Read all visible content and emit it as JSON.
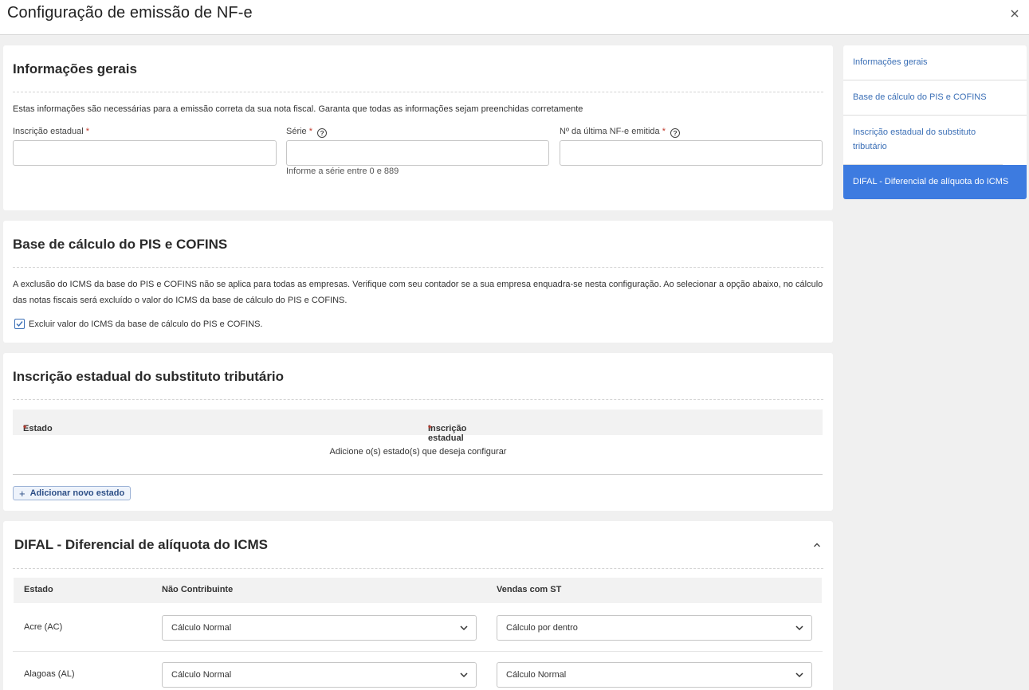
{
  "header": {
    "title": "Configuração de emissão de NF-e"
  },
  "section_general": {
    "title": "Informações gerais",
    "description": "Estas informações são necessárias para a emissão correta da sua nota fiscal. Garanta que todas as informações sejam preenchidas corretamente",
    "state_registration_label": "Inscrição estadual",
    "series_label": "Série",
    "series_hint": "Informe a série entre 0 e 889",
    "last_invoice_label": "Nº da última NF-e emitida",
    "required_mark": "*"
  },
  "section_pis_cofins": {
    "title": "Base de cálculo do PIS e COFINS",
    "description": "A exclusão do ICMS da base do PIS e COFINS não se aplica para todas as empresas. Verifique com seu contador se a sua empresa enquadra-se nesta configuração. Ao selecionar a opção abaixo, no cálculo das notas fiscais será excluído o valor do ICMS da base de cálculo do PIS e COFINS.",
    "checkbox_label": "Excluir valor do ICMS da base de cálculo do PIS e COFINS.",
    "checkbox_checked": true
  },
  "section_substitute": {
    "title": "Inscrição estadual do substituto tributário",
    "columns": [
      "Estado",
      "Inscrição estadual"
    ],
    "empty_message": "Adicione o(s) estado(s) que deseja configurar",
    "add_button": "Adicionar novo estado"
  },
  "section_difal": {
    "title": "DIFAL - Diferencial de alíquota do ICMS",
    "columns": [
      "Estado",
      "Não Contribuinte",
      "Vendas com ST"
    ],
    "rows": [
      {
        "state": "Acre (AC)",
        "non_contributor": "Cálculo Normal",
        "st_sales": "Cálculo por dentro"
      },
      {
        "state": "Alagoas (AL)",
        "non_contributor": "Cálculo Normal",
        "st_sales": "Cálculo Normal"
      }
    ]
  },
  "sidenav": {
    "items": [
      "Informações gerais",
      "Base de cálculo do PIS e COFINS",
      "Inscrição estadual do substituto tributário",
      "DIFAL - Diferencial de alíquota do ICMS"
    ],
    "active_index": 3
  },
  "colors": {
    "accent": "#3d7be0",
    "link": "#3b6fb6",
    "required": "#c0392b"
  }
}
